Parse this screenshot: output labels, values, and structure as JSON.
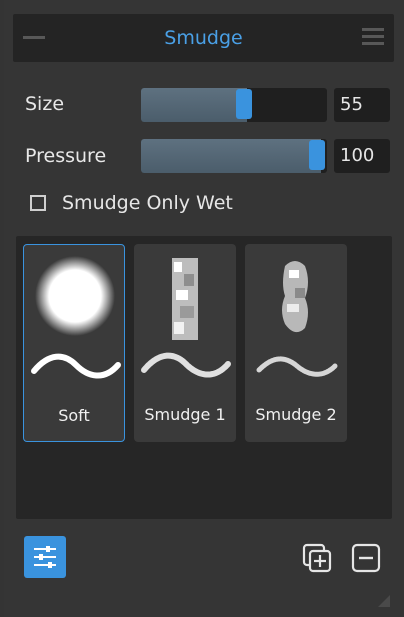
{
  "panel": {
    "title": "Smudge"
  },
  "size": {
    "label": "Size",
    "value": "55",
    "fraction": 0.55
  },
  "pressure": {
    "label": "Pressure",
    "value": "100",
    "fraction": 1.0
  },
  "smudge_only_wet": {
    "label": "Smudge Only Wet",
    "checked": false
  },
  "brushes": [
    {
      "label": "Soft",
      "selected": true
    },
    {
      "label": "Smudge 1",
      "selected": false
    },
    {
      "label": "Smudge 2",
      "selected": false
    }
  ],
  "colors": {
    "accent": "#3a93de",
    "title": "#4aa0e6",
    "background": "#353535"
  },
  "icons": {
    "header_left": "minus-grip-icon",
    "header_right": "hamburger-menu-icon",
    "settings": "sliders-icon",
    "duplicate": "duplicate-add-icon",
    "remove": "remove-minus-icon",
    "resize": "resize-grip-icon"
  }
}
